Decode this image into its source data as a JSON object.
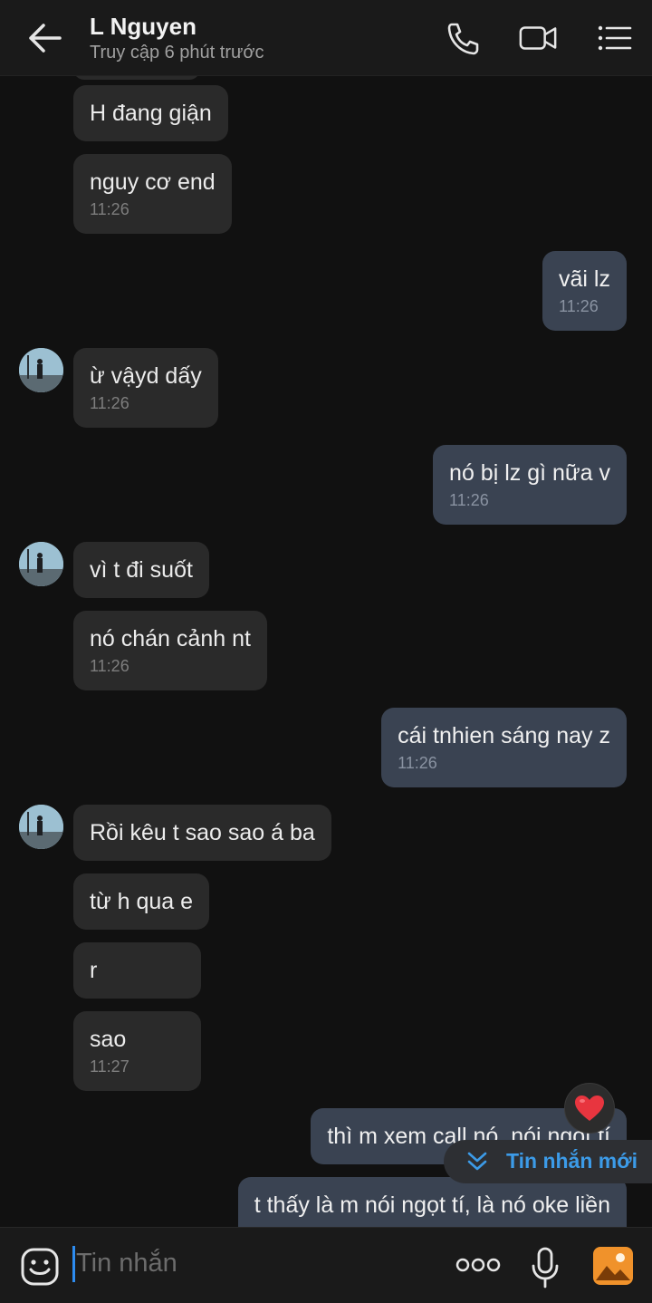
{
  "header": {
    "contact_name": "L Nguyen",
    "status": "Truy cập 6 phút trước"
  },
  "messages": [
    {
      "dir": "in",
      "text": "H đang giận",
      "time": ""
    },
    {
      "dir": "in",
      "text": "nguy cơ end",
      "time": "11:26"
    },
    {
      "dir": "out",
      "text": "vãi lz",
      "time": "11:26"
    },
    {
      "dir": "in",
      "text": "ừ vậyd dấy",
      "time": "11:26"
    },
    {
      "dir": "out",
      "text": "nó bị lz gì nữa v",
      "time": "11:26"
    },
    {
      "dir": "in",
      "text": "vì t đi suốt",
      "time": ""
    },
    {
      "dir": "in",
      "text": "nó chán cảnh nt",
      "time": "11:26"
    },
    {
      "dir": "out",
      "text": "cái tnhien sáng nay z",
      "time": "11:26"
    },
    {
      "dir": "in",
      "text": "Rồi kêu t sao sao á ba",
      "time": ""
    },
    {
      "dir": "in",
      "text": "từ h qua e",
      "time": ""
    },
    {
      "dir": "in",
      "text": "r",
      "time": ""
    },
    {
      "dir": "in",
      "text": "sao",
      "time": "11:27"
    },
    {
      "dir": "out",
      "text": "thì m xem call nó, nói ngọt tí",
      "time": ""
    },
    {
      "dir": "out",
      "text": "t thấy là m nói ngọt tí, là nó oke liền",
      "time": ""
    }
  ],
  "reaction": {
    "icon": "heart-icon",
    "color": "#e8353f"
  },
  "new_message_pill": {
    "label": "Tin nhắn mới",
    "color": "#3c9be8"
  },
  "composer": {
    "placeholder": "Tin nhắn"
  },
  "colors": {
    "accent": "#2d8cf0",
    "outgoing_bubble": "#3a4352",
    "incoming_bubble": "#2a2a2a",
    "background": "#111111"
  }
}
